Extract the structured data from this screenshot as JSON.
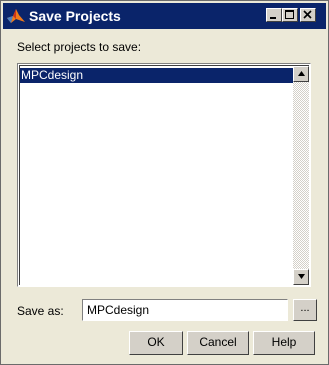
{
  "window": {
    "title": "Save Projects",
    "icon": "matlab-membrane-icon"
  },
  "title_buttons": {
    "minimize_icon": "minimize-icon",
    "maximize_icon": "maximize-icon",
    "close_icon": "close-icon"
  },
  "select_label": "Select projects to save:",
  "projects": {
    "items": [
      {
        "label": "MPCdesign",
        "selected": true
      }
    ]
  },
  "save_as": {
    "label": "Save as:",
    "value": "MPCdesign",
    "browse_label": "..."
  },
  "buttons": {
    "ok": "OK",
    "cancel": "Cancel",
    "help": "Help"
  },
  "colors": {
    "titlebar": "#0a246a",
    "selection": "#0a246a",
    "dialog_bg": "#ece9d8"
  }
}
